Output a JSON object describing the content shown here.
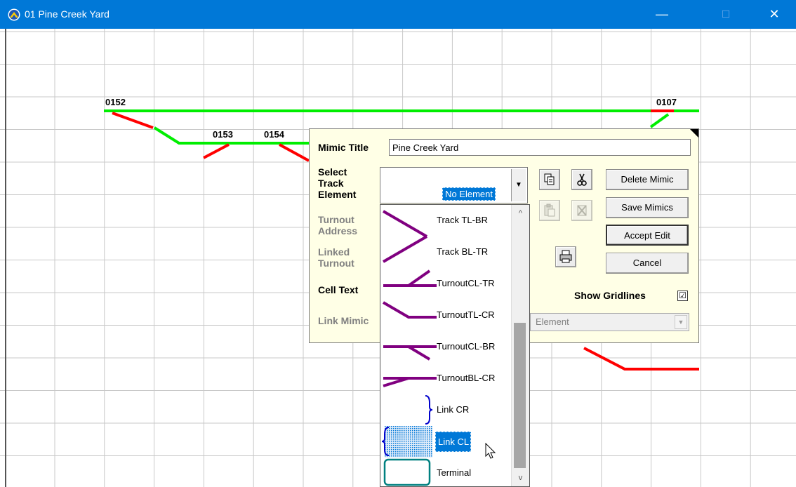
{
  "window": {
    "title": "01 Pine Creek Yard",
    "minimize": "—",
    "maximize": "☐",
    "close": "✕"
  },
  "canvas": {
    "cells": [
      {
        "text": "0152",
        "track_id": "0152"
      },
      {
        "text": "0153",
        "track_id": "0153"
      },
      {
        "text": "0154",
        "track_id": "0154"
      },
      {
        "text": "0107",
        "track_id": "0107"
      }
    ],
    "colors": {
      "occupied": "#ff0000",
      "clear": "#00ee00",
      "grid": "#c8c8c8"
    }
  },
  "dialog": {
    "mimic_title_label": "Mimic Title",
    "mimic_title_value": "Pine Creek Yard",
    "select_track_label_1": "Select",
    "select_track_label_2": "Track",
    "select_track_label_3": "Element",
    "select_track_value": "No Element",
    "turnout_address_label_1": "Turnout",
    "turnout_address_label_2": "Address",
    "linked_turnout_label_1": "Linked",
    "linked_turnout_label_2": "Turnout",
    "cell_text_label": "Cell Text",
    "link_mimic_label": "Link Mimic",
    "link_mimic_value": "Element",
    "show_gridlines_label": "Show Gridlines",
    "show_gridlines_checked": "☑",
    "buttons": {
      "delete_mimic": "Delete Mimic",
      "save_mimics": "Save Mimics",
      "accept_edit": "Accept Edit",
      "cancel": "Cancel"
    },
    "icons": [
      "copy-icon",
      "cut-icon",
      "paste-icon",
      "delete-icon",
      "print-icon"
    ]
  },
  "dropdown": {
    "items": [
      {
        "label": "Track TL-BR",
        "icon": "track-tl-br"
      },
      {
        "label": "Track BL-TR",
        "icon": "track-bl-tr"
      },
      {
        "label": "TurnoutCL-TR",
        "icon": "turnout-cl-tr"
      },
      {
        "label": "TurnoutTL-CR",
        "icon": "turnout-tl-cr"
      },
      {
        "label": "TurnoutCL-BR",
        "icon": "turnout-cl-br"
      },
      {
        "label": "TurnoutBL-CR",
        "icon": "turnout-bl-cr"
      },
      {
        "label": "Link CR",
        "icon": "link-cr"
      },
      {
        "label": "Link CL",
        "icon": "link-cl",
        "selected": true
      },
      {
        "label": "Terminal",
        "icon": "terminal"
      }
    ],
    "colors": {
      "track": "#800080",
      "link": "#0000cc",
      "terminal": "#008080",
      "selection": "#0078d7"
    }
  }
}
